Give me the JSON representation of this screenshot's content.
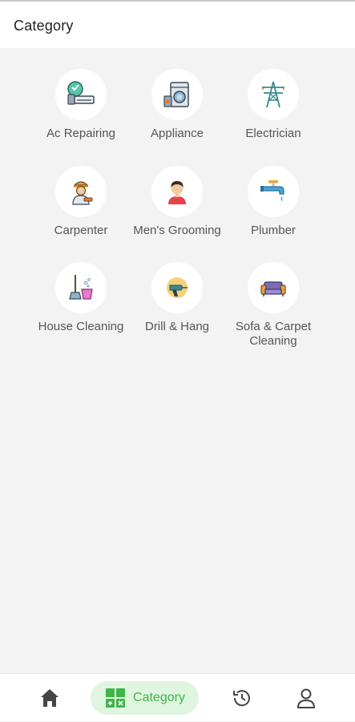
{
  "header": {
    "title": "Category"
  },
  "categories": [
    {
      "label": "Ac Repairing",
      "icon": "ac-repair-icon"
    },
    {
      "label": "Appliance",
      "icon": "washing-machine-icon"
    },
    {
      "label": "Electrician",
      "icon": "electric-tower-icon"
    },
    {
      "label": "Carpenter",
      "icon": "carpenter-icon"
    },
    {
      "label": "Men's Grooming",
      "icon": "man-avatar-icon"
    },
    {
      "label": "Plumber",
      "icon": "water-tap-icon"
    },
    {
      "label": "House Cleaning",
      "icon": "mop-bucket-icon"
    },
    {
      "label": "Drill & Hang",
      "icon": "drill-icon"
    },
    {
      "label": "Sofa & Carpet Cleaning",
      "icon": "sofa-icon"
    }
  ],
  "bottom_nav": {
    "items": [
      {
        "icon": "home-icon"
      },
      {
        "label": "Category",
        "icon": "category-grid-icon",
        "active": true
      },
      {
        "icon": "history-icon"
      },
      {
        "icon": "profile-icon"
      }
    ]
  },
  "colors": {
    "accent": "#3fb54a",
    "accent_bg": "#dff5df",
    "background": "#f3f3f3"
  }
}
